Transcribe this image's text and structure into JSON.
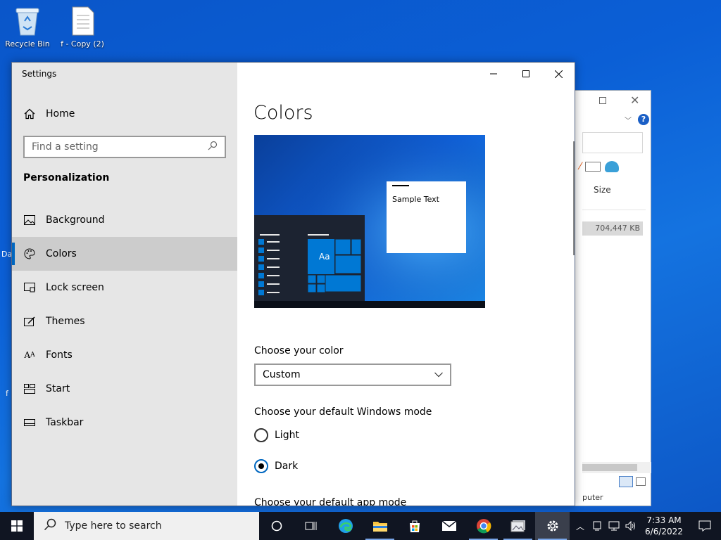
{
  "desktop": {
    "icons": [
      {
        "label": "Recycle Bin",
        "icon": "recycle-bin-icon"
      },
      {
        "label": "f - Copy (2)",
        "icon": "text-file-icon"
      }
    ],
    "edge_fragments": [
      "Da",
      "f"
    ]
  },
  "background_window": {
    "column_header": "Size",
    "file_size": "704,447 KB",
    "status_text": "puter"
  },
  "settings": {
    "window_title": "Settings",
    "home_label": "Home",
    "search_placeholder": "Find a setting",
    "section_heading": "Personalization",
    "nav": [
      {
        "label": "Background",
        "icon": "picture-icon"
      },
      {
        "label": "Colors",
        "icon": "palette-icon",
        "active": true
      },
      {
        "label": "Lock screen",
        "icon": "lock-screen-icon"
      },
      {
        "label": "Themes",
        "icon": "themes-icon"
      },
      {
        "label": "Fonts",
        "icon": "fonts-icon"
      },
      {
        "label": "Start",
        "icon": "start-icon"
      },
      {
        "label": "Taskbar",
        "icon": "taskbar-icon"
      }
    ],
    "page_title": "Colors",
    "preview": {
      "sample_text": "Sample Text",
      "tile_text": "Aa"
    },
    "choose_color_label": "Choose your color",
    "color_value": "Custom",
    "windows_mode_label": "Choose your default Windows mode",
    "windows_mode_options": [
      {
        "label": "Light",
        "selected": false
      },
      {
        "label": "Dark",
        "selected": true
      }
    ],
    "app_mode_label": "Choose your default app mode",
    "accent_color": "#0067c0"
  },
  "taskbar": {
    "search_placeholder": "Type here to search",
    "apps": [
      "cortana-icon",
      "task-view-icon",
      "edge-icon",
      "file-explorer-icon",
      "store-icon",
      "mail-icon",
      "chrome-icon",
      "photos-icon",
      "settings-icon"
    ],
    "clock_time": "7:33 AM",
    "clock_date": "6/6/2022"
  }
}
